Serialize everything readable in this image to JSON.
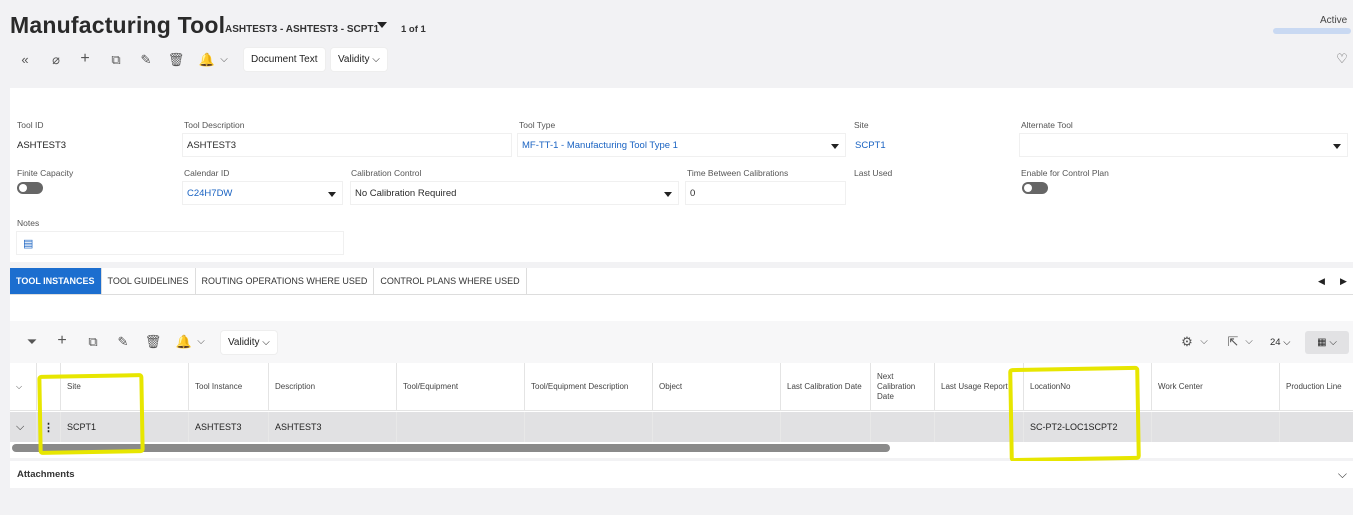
{
  "header": {
    "title": "Manufacturing Tool",
    "breadcrumb": "ASHTEST3 - ASHTEST3 - SCPT1",
    "record_count": "1 of 1",
    "status": "Active"
  },
  "toolbar": {
    "icons": [
      "collapse-icon",
      "attach-icon",
      "add-icon",
      "duplicate-icon",
      "edit-icon",
      "delete-icon",
      "bell-icon"
    ],
    "document_text": "Document Text",
    "validity": "Validity"
  },
  "form": {
    "tool_id": {
      "label": "Tool ID",
      "value": "ASHTEST3"
    },
    "tool_description": {
      "label": "Tool Description",
      "value": "ASHTEST3"
    },
    "tool_type": {
      "label": "Tool Type",
      "value": "MF-TT-1 - Manufacturing Tool Type 1"
    },
    "site": {
      "label": "Site",
      "value": "SCPT1"
    },
    "alternate_tool": {
      "label": "Alternate Tool",
      "value": ""
    },
    "finite_capacity": {
      "label": "Finite Capacity",
      "on": false
    },
    "calendar_id": {
      "label": "Calendar ID",
      "value": "C24H7DW"
    },
    "calibration_control": {
      "label": "Calibration Control",
      "value": "No Calibration Required"
    },
    "time_between_calibrations": {
      "label": "Time Between Calibrations",
      "value": "0"
    },
    "last_used": {
      "label": "Last Used",
      "value": ""
    },
    "enable_control_plan": {
      "label": "Enable for Control Plan",
      "on": false
    },
    "notes": {
      "label": "Notes",
      "value": ""
    }
  },
  "tabs": [
    "TOOL INSTANCES",
    "TOOL GUIDELINES",
    "ROUTING OPERATIONS WHERE USED",
    "CONTROL PLANS WHERE USED"
  ],
  "grid_toolbar": {
    "validity": "Validity",
    "page_size": "24"
  },
  "table": {
    "columns": [
      "Site",
      "Tool Instance",
      "Description",
      "Tool/Equipment",
      "Tool/Equipment Description",
      "Object",
      "Last Calibration Date",
      "Next Calibration Date",
      "Last Usage Report",
      "LocationNo",
      "Work Center",
      "Production Line"
    ],
    "rows": [
      [
        "SCPT1",
        "ASHTEST3",
        "ASHTEST3",
        "",
        "",
        "",
        "",
        "",
        "",
        "SC-PT2-LOC1SCPT2",
        "",
        ""
      ]
    ]
  },
  "attachments_label": "Attachments",
  "colors": {
    "accent": "#1c6ecf",
    "highlight": "#e7e600",
    "link": "#1a63c2"
  }
}
